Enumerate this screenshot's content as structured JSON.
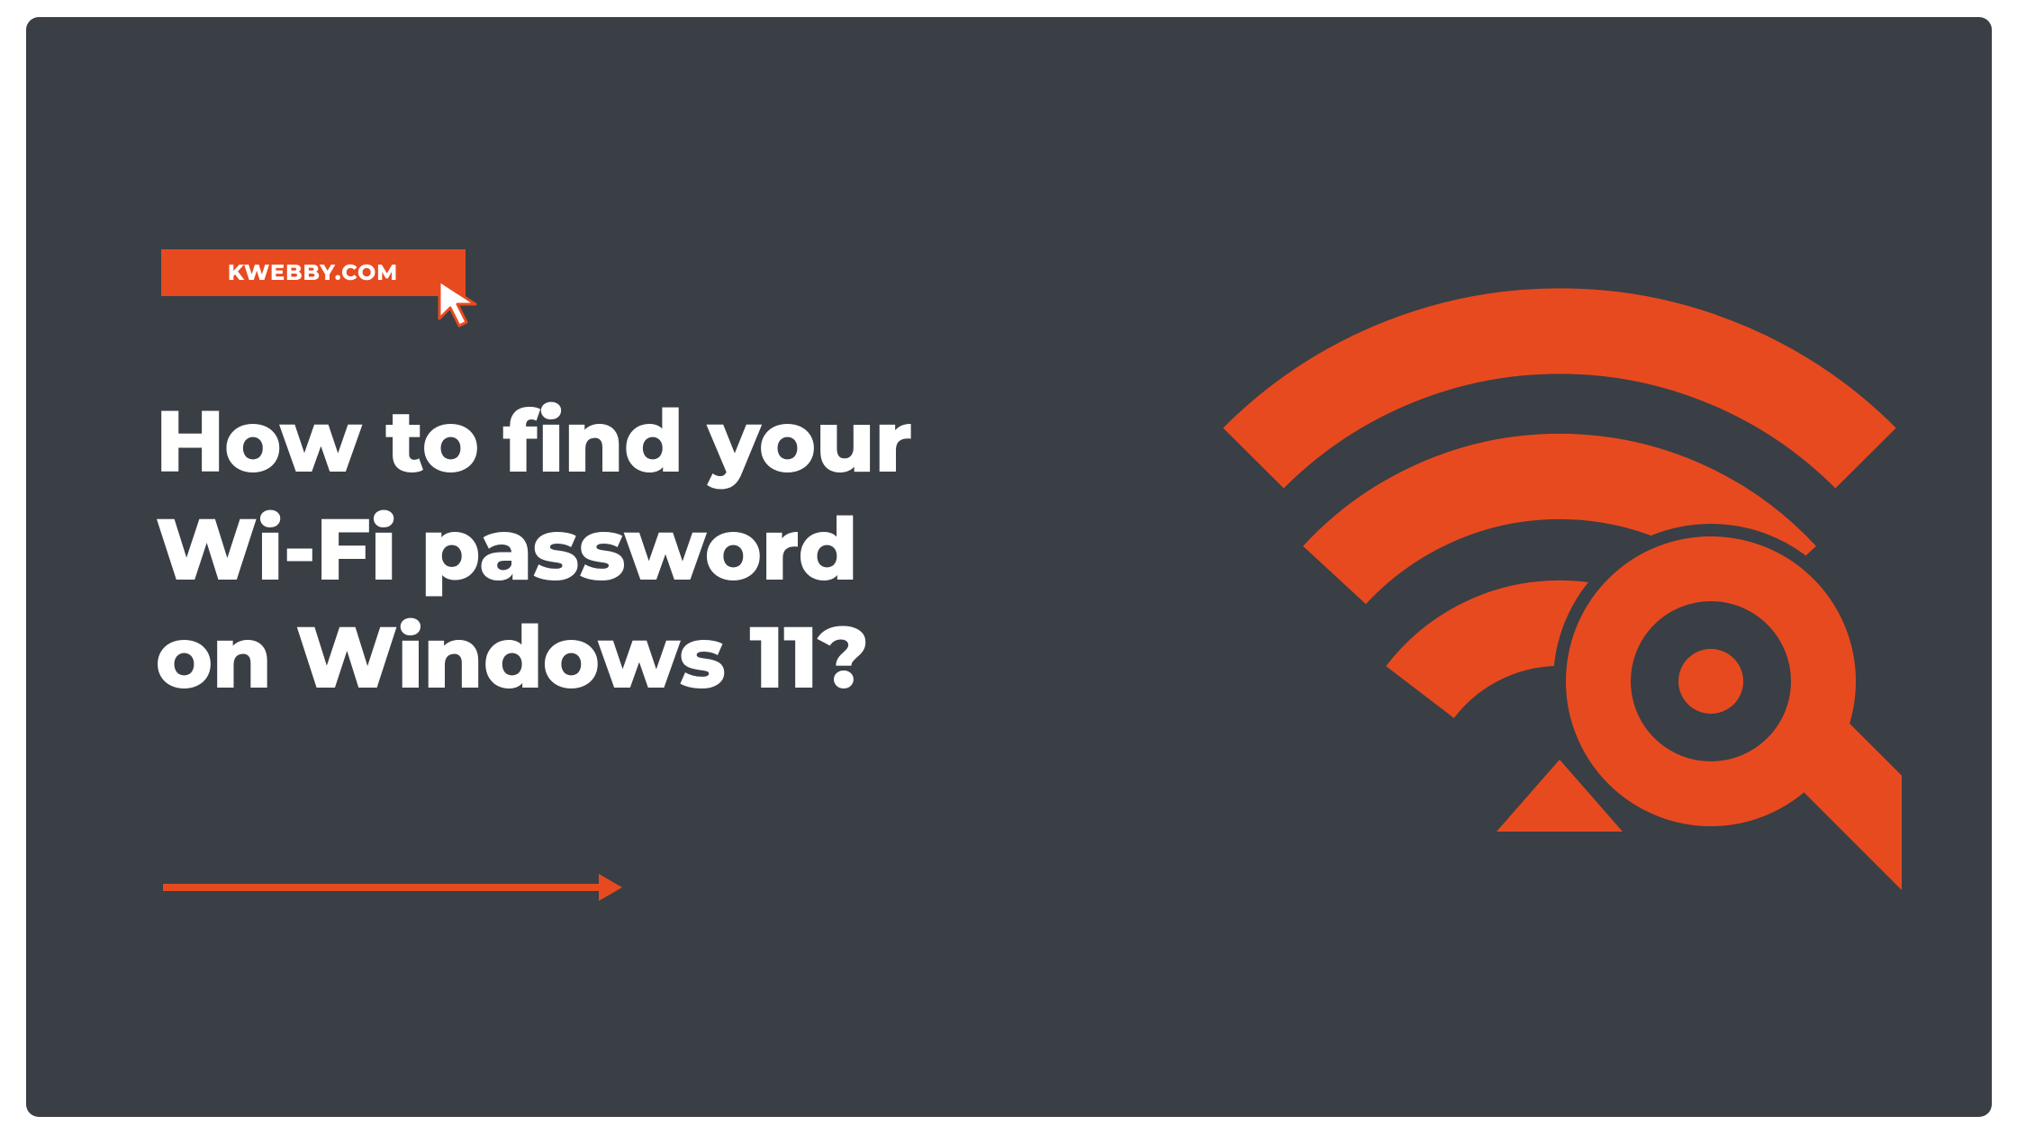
{
  "badge": {
    "label": "KWEBBY.COM"
  },
  "headline": {
    "line1": "How to find your",
    "line2": "Wi-Fi password",
    "line3": "on Windows 11?"
  },
  "colors": {
    "background": "#3a3e45",
    "accent": "#e84a1f",
    "text": "#ffffff"
  },
  "icons": {
    "cursor": "cursor-icon",
    "arrow": "arrow-right-icon",
    "graphic": "wifi-search-icon"
  }
}
